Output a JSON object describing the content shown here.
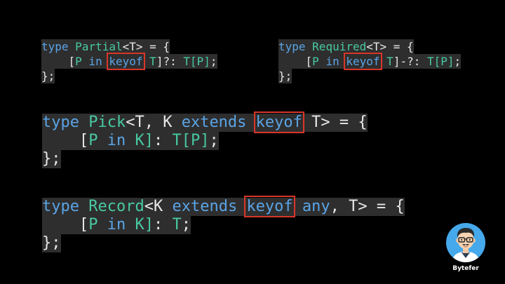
{
  "snippets": {
    "partial": {
      "line1": {
        "kw": "type",
        "name": "Partial",
        "generic": "<T>",
        "rest": " = {"
      },
      "line2": {
        "indent": "    ",
        "open": "[",
        "p": "P",
        "in": "in",
        "keyof": "keyof",
        "t": "T",
        "close": "]?: ",
        "tp": "T[P]",
        "semi": ";"
      },
      "line3": "};"
    },
    "required": {
      "line1": {
        "kw": "type",
        "name": "Required",
        "generic": "<T>",
        "rest": " = {"
      },
      "line2": {
        "indent": "    ",
        "open": "[",
        "p": "P",
        "in": "in",
        "keyof": "keyof",
        "t": "T",
        "close": "]-?: ",
        "tp": "T[P]",
        "semi": ";"
      },
      "line3": "};"
    },
    "pick": {
      "line1": {
        "kw": "type",
        "name": "Pick",
        "generic_open": "<T, K ",
        "extends": "extends",
        "keyof": "keyof",
        "generic_close": "T>",
        "rest": " = {"
      },
      "line2": {
        "indent": "    ",
        "open": "[",
        "p": "P",
        "in": "in",
        "k": "K]",
        "colon": ": ",
        "tp": "T[P]",
        "semi": ";"
      },
      "line3": "};"
    },
    "record": {
      "line1": {
        "kw": "type",
        "name": "Record",
        "generic_open": "<K ",
        "extends": "extends",
        "keyof": "keyof",
        "any": "any",
        "generic_close": ", T>",
        "rest": " = {"
      },
      "line2": {
        "indent": "    ",
        "open": "[",
        "p": "P",
        "in": "in",
        "k": "K]",
        "colon": ": ",
        "t": "T",
        "semi": ";"
      },
      "line3": "};"
    }
  },
  "brand": {
    "name": "Bytefer",
    "avatar_icon": "developer-avatar-icon"
  },
  "colors": {
    "background": "#000000",
    "code_bg": "#2e2e2e",
    "keyword": "#5aa4e6",
    "type_name": "#48c9a2",
    "highlight_box": "#d8362a"
  }
}
